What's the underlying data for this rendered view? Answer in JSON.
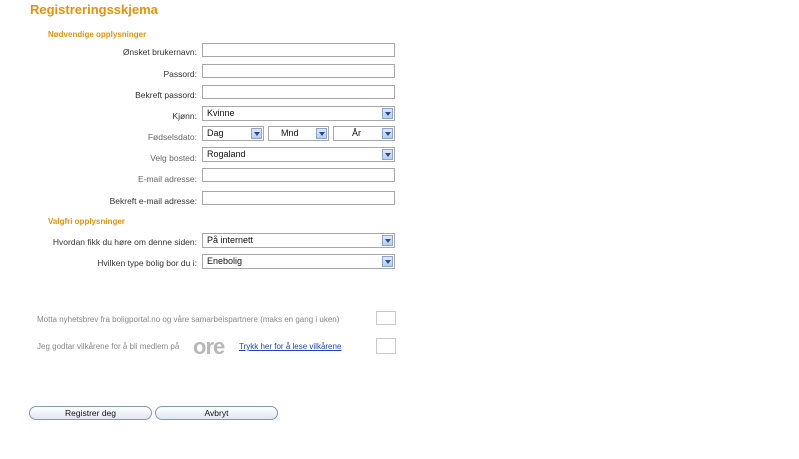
{
  "form": {
    "title": "Registreringsskjema",
    "required_section": "Nødvendige opplysninger",
    "optional_section": "Valgfri opplysninger",
    "fields": {
      "username": {
        "label": "Ønsket brukernavn:",
        "value": ""
      },
      "password": {
        "label": "Passord:",
        "value": ""
      },
      "confirm_password": {
        "label": "Bekreft passord:",
        "value": ""
      },
      "gender": {
        "label": "Kjønn:",
        "selected": "Kvinne"
      },
      "birthdate": {
        "label": "Fødselsdato:",
        "day": "Dag",
        "month": "Mnd",
        "year": "År"
      },
      "residence": {
        "label": "Velg bosted:",
        "selected": "Rogaland"
      },
      "email": {
        "label": "E-mail adresse:",
        "value": ""
      },
      "confirm_email": {
        "label": "Bekreft e-mail adresse:",
        "value": ""
      },
      "heard_about": {
        "label": "Hvordan fikk du høre om denne siden:",
        "selected": "På internett"
      },
      "housing_type": {
        "label": "Hvilken type bolig bor du i:",
        "selected": "Enebolig"
      }
    },
    "newsletter": {
      "label": "Motta nyhetsbrev fra boligportal.no og våre samarbeispartnere (maks en gang i uken)",
      "checked": false
    },
    "terms": {
      "label": "Jeg godtar vilkårene for å bli medlem på",
      "captcha_text": "ore",
      "link_text": "Trykk her for å lese vilkårene",
      "checked": false
    },
    "buttons": {
      "register": "Registrer deg",
      "cancel": "Avbryt"
    }
  }
}
